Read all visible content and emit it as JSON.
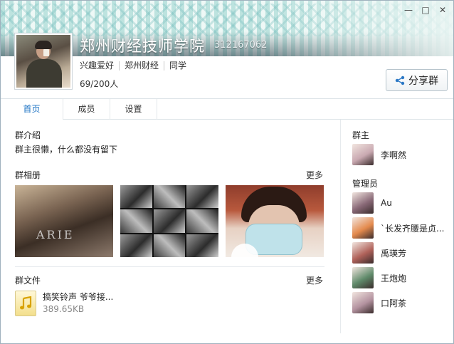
{
  "window": {
    "controls": {
      "minimize": "—",
      "maximize": "□",
      "close": "✕"
    }
  },
  "group": {
    "name": "郑州财经技师学院",
    "id": "312167062",
    "tags": [
      "兴趣爱好",
      "郑州财经",
      "同学"
    ],
    "members": "69/200人",
    "share_label": "分享群"
  },
  "tabs": [
    {
      "label": "首页",
      "active": true
    },
    {
      "label": "成员",
      "active": false
    },
    {
      "label": "设置",
      "active": false
    }
  ],
  "main": {
    "intro_title": "群介绍",
    "intro_text": "群主很懒，什么都没有留下",
    "album_title": "群相册",
    "album_more": "更多",
    "photo1_text": "ARIE",
    "files_title": "群文件",
    "files_more": "更多",
    "file": {
      "name": "搞笑铃声 爷爷接...",
      "size": "389.65KB",
      "icon": "music-note-icon"
    }
  },
  "side": {
    "owner_title": "群主",
    "owner": {
      "name": "李啊然",
      "color": "#c9a9b1"
    },
    "admins_title": "管理员",
    "admins": [
      {
        "name": "Au",
        "color": "#8a6a78"
      },
      {
        "name": "`长发齐腰是贞...",
        "color": "#e48a4d"
      },
      {
        "name": "禹瑛芳",
        "color": "#b0625a"
      },
      {
        "name": "王炮炮",
        "color": "#5f8a6a"
      },
      {
        "name": "口阿茶",
        "color": "#b493a0"
      }
    ]
  }
}
